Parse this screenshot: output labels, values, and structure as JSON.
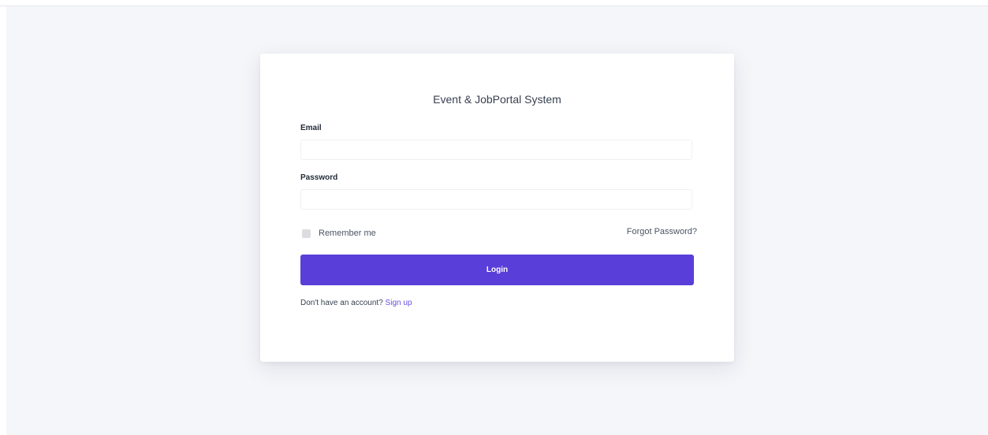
{
  "app": {
    "title": "Event & JobPortal System"
  },
  "form": {
    "email_label": "Email",
    "email_value": "",
    "password_label": "Password",
    "password_value": "",
    "remember_label": "Remember me",
    "remember_checked": false,
    "forgot_label": "Forgot Password?",
    "login_label": "Login",
    "signup_prompt": "Don't have an account?",
    "signup_label": "Sign up"
  },
  "colors": {
    "accent": "#5a3ed9",
    "link": "#6a4fe6",
    "background": "#f5f6fa"
  }
}
